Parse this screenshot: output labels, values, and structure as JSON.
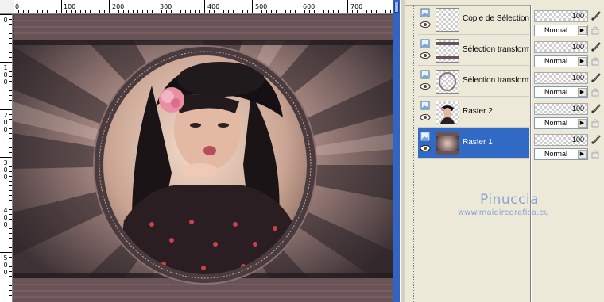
{
  "canvas": {
    "ruler_top_labels": [
      "0",
      "100",
      "200",
      "300",
      "400",
      "500",
      "600",
      "700"
    ],
    "ruler_left_labels": [
      "0",
      "1",
      "0",
      "0",
      "2",
      "0",
      "0",
      "3",
      "0",
      "0",
      "4",
      "0",
      "0",
      "5",
      "0",
      "0"
    ],
    "artwork_description": "photo-frame"
  },
  "layers": [
    {
      "name": "Copie de Sélection",
      "opacity": "100",
      "blend": "Normal",
      "thumb": "empty",
      "selected": false
    },
    {
      "name": "Sélection transform",
      "opacity": "100",
      "blend": "Normal",
      "thumb": "frame",
      "selected": false
    },
    {
      "name": "Sélection transform",
      "opacity": "100",
      "blend": "Normal",
      "thumb": "circle",
      "selected": false
    },
    {
      "name": "Raster 2",
      "opacity": "100",
      "blend": "Normal",
      "thumb": "portrait",
      "selected": false
    },
    {
      "name": "Raster 1",
      "opacity": "100",
      "blend": "Normal",
      "thumb": "background",
      "selected": true
    }
  ],
  "watermark": {
    "name": "Pinuccia",
    "url": "www.maidiregrafica.eu"
  },
  "colors": {
    "selected_row": "#316ac5",
    "titlebar_blue": "#3164c4",
    "watermark": "#8aa6d6"
  }
}
